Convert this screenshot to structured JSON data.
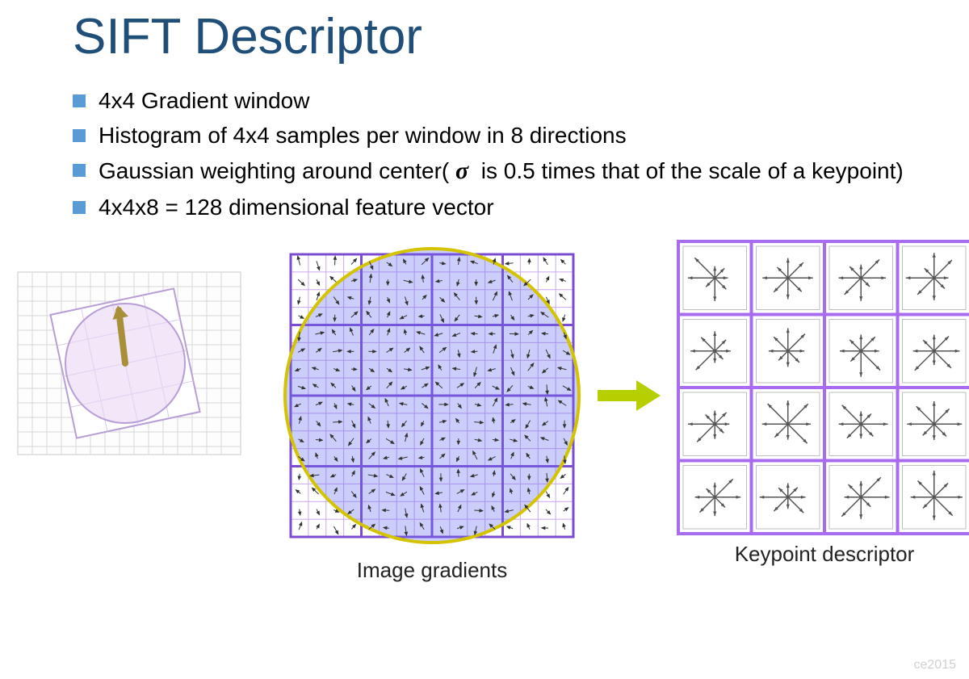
{
  "title": "SIFT Descriptor",
  "bullets": [
    "4x4 Gradient window",
    "Histogram of 4x4 samples per window in 8 directions",
    "Gaussian weighting around center( σ  is 0.5 times that of the scale of a keypoint)",
    "4x4x8 = 128 dimensional feature vector"
  ],
  "labels": {
    "gradients": "Image gradients",
    "descriptor": "Keypoint descriptor"
  },
  "watermark": "ce2015"
}
